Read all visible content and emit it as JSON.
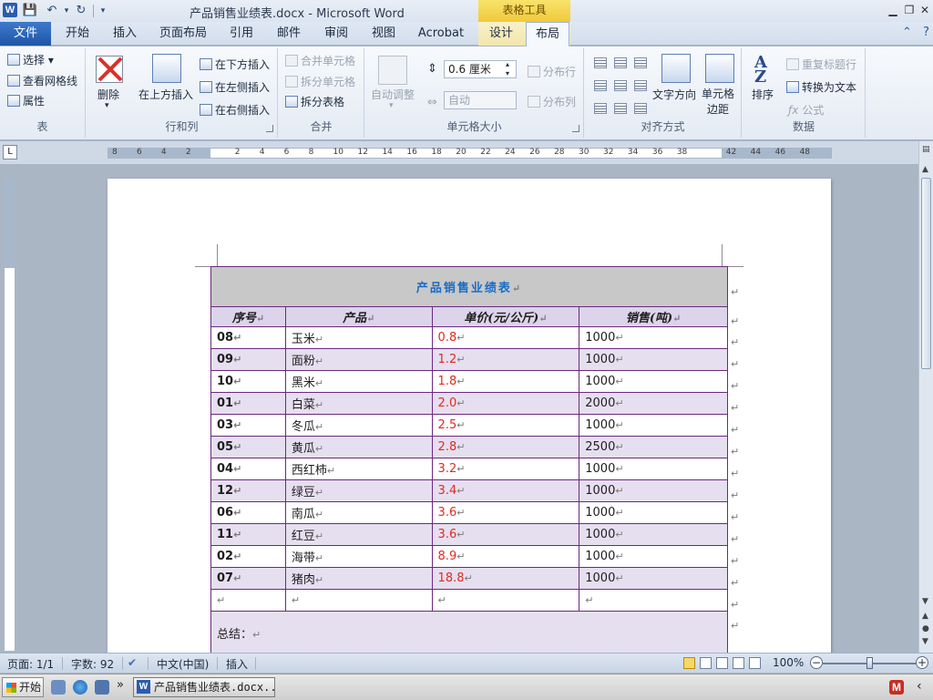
{
  "window": {
    "app_icon": "W",
    "title": "产品销售业绩表.docx - Microsoft Word",
    "context_tab_group": "表格工具",
    "controls": [
      "minimize-icon",
      "restore-icon",
      "close-icon"
    ]
  },
  "quick_access": [
    "save-icon",
    "undo-icon",
    "redo-icon",
    "customize-icon"
  ],
  "tabs": {
    "file": "文件",
    "items": [
      "开始",
      "插入",
      "页面布局",
      "引用",
      "邮件",
      "审阅",
      "视图",
      "Acrobat",
      "设计",
      "布局"
    ],
    "active": "布局"
  },
  "ribbon": {
    "table": {
      "label": "表",
      "select": "选择",
      "view_gridlines": "查看网格线",
      "properties": "属性"
    },
    "rows_cols": {
      "label": "行和列",
      "delete": "删除",
      "insert_above": "在上方插入",
      "insert_below": "在下方插入",
      "insert_left": "在左侧插入",
      "insert_right": "在右侧插入"
    },
    "merge": {
      "label": "合并",
      "merge_cells": "合并单元格",
      "split_cells": "拆分单元格",
      "split_table": "拆分表格"
    },
    "cell_size": {
      "label": "单元格大小",
      "autofit": "自动调整",
      "height_value": "0.6 厘米",
      "width_value": "自动",
      "distribute_rows": "分布行",
      "distribute_cols": "分布列"
    },
    "alignment": {
      "label": "对齐方式",
      "text_direction": "文字方向",
      "cell_margins": "单元格边距"
    },
    "data": {
      "label": "数据",
      "sort": "排序",
      "repeat_header": "重复标题行",
      "convert_to_text": "转换为文本",
      "formula": "公式"
    }
  },
  "ruler": {
    "corner": "L",
    "ticks": [
      "8",
      "6",
      "4",
      "2",
      "",
      "2",
      "4",
      "6",
      "8",
      "10",
      "12",
      "14",
      "16",
      "18",
      "20",
      "22",
      "24",
      "26",
      "28",
      "30",
      "32",
      "34",
      "36",
      "38",
      "",
      "42",
      "44",
      "46",
      "48"
    ]
  },
  "document": {
    "table_title": "产品销售业绩表",
    "headers": [
      "序号",
      "产品",
      "单价(元/公斤)",
      "销售(吨)"
    ],
    "rows": [
      [
        "08",
        "玉米",
        "0.8",
        "1000"
      ],
      [
        "09",
        "面粉",
        "1.2",
        "1000"
      ],
      [
        "10",
        "黑米",
        "1.8",
        "1000"
      ],
      [
        "01",
        "白菜",
        "2.0",
        "2000"
      ],
      [
        "03",
        "冬瓜",
        "2.5",
        "1000"
      ],
      [
        "05",
        "黄瓜",
        "2.8",
        "2500"
      ],
      [
        "04",
        "西红柿",
        "3.2",
        "1000"
      ],
      [
        "12",
        "绿豆",
        "3.4",
        "1000"
      ],
      [
        "06",
        "南瓜",
        "3.6",
        "1000"
      ],
      [
        "11",
        "红豆",
        "3.6",
        "1000"
      ],
      [
        "02",
        "海带",
        "8.9",
        "1000"
      ],
      [
        "07",
        "猪肉",
        "18.8",
        "1000"
      ]
    ],
    "summary_label": "总结：",
    "para_mark": "↵",
    "colors": {
      "title": "#1a6dc5",
      "price": "#e02b1f",
      "border": "#6a2a7d",
      "stripe": "#e6dff0"
    }
  },
  "statusbar": {
    "page": "页面: 1/1",
    "words": "字数: 92",
    "language": "中文(中国)",
    "mode": "插入",
    "zoom": "100%",
    "zoom_out": "−",
    "zoom_in": "+"
  },
  "taskbar": {
    "start": "开始",
    "task_label": "产品销售业绩表.docx...",
    "overflow": "»"
  }
}
